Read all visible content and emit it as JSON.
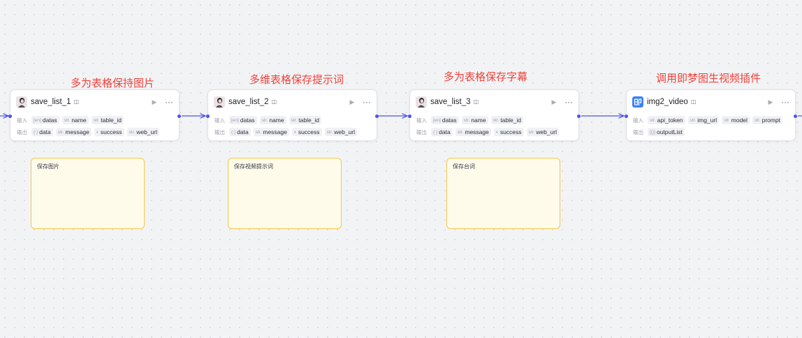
{
  "annotations": [
    "多为表格保持图片",
    "多维表格保存提示词",
    "多为表格保存字幕",
    "调用即梦图生视频插件"
  ],
  "labels": {
    "input": "输入",
    "output": "输出"
  },
  "icons": {
    "run": "play-icon",
    "more": "more-icon",
    "badge": "badge-icon"
  },
  "nodes": [
    {
      "name": "save_list_1",
      "icon": "avatar-image-icon",
      "inputs": [
        {
          "type": "[en]",
          "name": "datas"
        },
        {
          "type": "str.",
          "name": "name"
        },
        {
          "type": "str.",
          "name": "table_id"
        }
      ],
      "outputs": [
        {
          "type": "{ }",
          "name": "data"
        },
        {
          "type": "str.",
          "name": "message"
        },
        {
          "type": "",
          "name": "success"
        },
        {
          "type": "str.",
          "name": "web_url"
        }
      ]
    },
    {
      "name": "save_list_2",
      "icon": "avatar-image-icon",
      "inputs": [
        {
          "type": "[en]",
          "name": "datas"
        },
        {
          "type": "str.",
          "name": "name"
        },
        {
          "type": "str.",
          "name": "table_id"
        }
      ],
      "outputs": [
        {
          "type": "{ }",
          "name": "data"
        },
        {
          "type": "str.",
          "name": "message"
        },
        {
          "type": "",
          "name": "success"
        },
        {
          "type": "str.",
          "name": "web_url"
        }
      ]
    },
    {
      "name": "save_list_3",
      "icon": "avatar-image-icon",
      "inputs": [
        {
          "type": "[en]",
          "name": "datas"
        },
        {
          "type": "str.",
          "name": "name"
        },
        {
          "type": "str.",
          "name": "table_id"
        }
      ],
      "outputs": [
        {
          "type": "{ }",
          "name": "data"
        },
        {
          "type": "str.",
          "name": "message"
        },
        {
          "type": "",
          "name": "success"
        },
        {
          "type": "str.",
          "name": "web_url"
        }
      ]
    },
    {
      "name": "img2_video",
      "icon": "jimeng-plugin-icon",
      "inputs": [
        {
          "type": "str.",
          "name": "api_token"
        },
        {
          "type": "str.",
          "name": "img_url"
        },
        {
          "type": "str.",
          "name": "model"
        },
        {
          "type": "str.",
          "name": "prompt"
        }
      ],
      "outputs": [
        {
          "type": "[{}]",
          "name": "outputList"
        }
      ]
    }
  ],
  "notes": [
    "保存图片",
    "保存视频提示词",
    "保存台词"
  ],
  "colors": {
    "accent": "#4d53e8",
    "annotation": "#f0423a",
    "note_border": "#f5c74a",
    "note_fill": "#fffbeb",
    "plugin_icon": "#3b82f6"
  }
}
